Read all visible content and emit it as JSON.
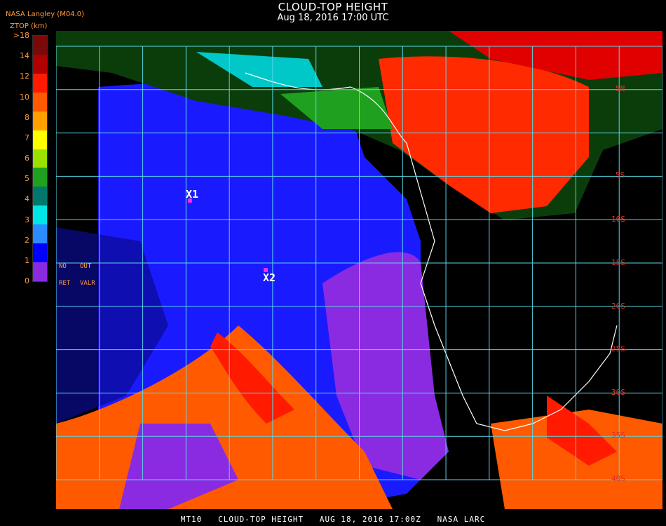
{
  "header": {
    "title": "CLOUD-TOP HEIGHT",
    "subtitle": "Aug 18, 2016 17:00 UTC",
    "org": "NASA Langley (M04.0)",
    "unit": "ZTOP (km)"
  },
  "legend": {
    "labels": [
      ">18",
      "14",
      "12",
      "10",
      "8",
      "7",
      "6",
      "5",
      "4",
      "3",
      "2",
      "1",
      "0"
    ],
    "colors": [
      "#7a0a0a",
      "#b00000",
      "#ff1a00",
      "#ff5a00",
      "#ffa000",
      "#ffff00",
      "#9be000",
      "#1fa01f",
      "#00796b",
      "#00e5e5",
      "#2a8cff",
      "#0000ff",
      "#8a2be2"
    ]
  },
  "colors": {
    "ocean": "#1a1aff",
    "low": "#8a2be2",
    "high": "#ff2a00",
    "grid": "#5ad6e6",
    "coast": "#ffffff",
    "marker": "#ff2be0"
  },
  "markers": {
    "x1": "X1",
    "x2": "X2"
  },
  "lat_labels": [
    "5N",
    "5S",
    "10S",
    "15S",
    "20S",
    "25S",
    "30S",
    "35S",
    "40S"
  ],
  "notes": {
    "no": "NO",
    "out": "OUT",
    "ret": "RET",
    "valr": "VALR"
  },
  "footer": "MT10   CLOUD-TOP HEIGHT   AUG 18, 2016 17:00Z   NASA LARC"
}
